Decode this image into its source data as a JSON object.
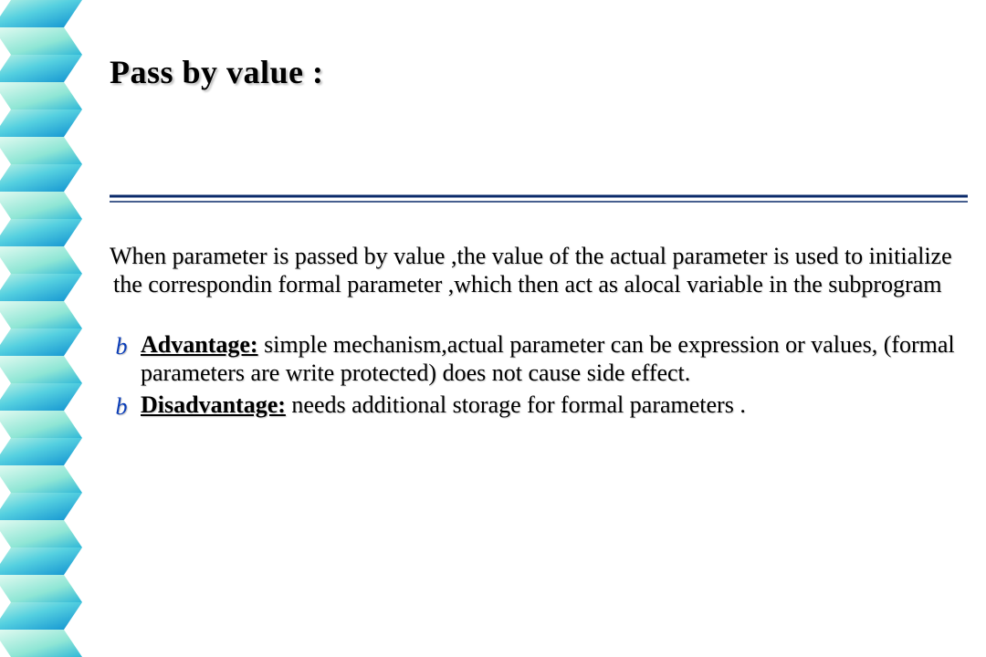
{
  "title": "Pass by value :",
  "paragraph": "When parameter is passed by value ,the value of the actual parameter is used to initialize the correspondin formal parameter ,which then act as alocal variable in the subprogram",
  "bullets": [
    {
      "marker": "b",
      "label": "Advantage:",
      "text": " simple mechanism,actual parameter can be expression or values, (formal parameters are write protected) does not cause side effect."
    },
    {
      "marker": "b",
      "label": "Disadvantage:",
      "text": " needs additional storage for formal parameters ."
    }
  ],
  "colors": {
    "spiral_light": "#9be8d8",
    "spiral_dark": "#1da0d8",
    "rule": "#0a2a6a",
    "marker": "#0a3db8"
  }
}
